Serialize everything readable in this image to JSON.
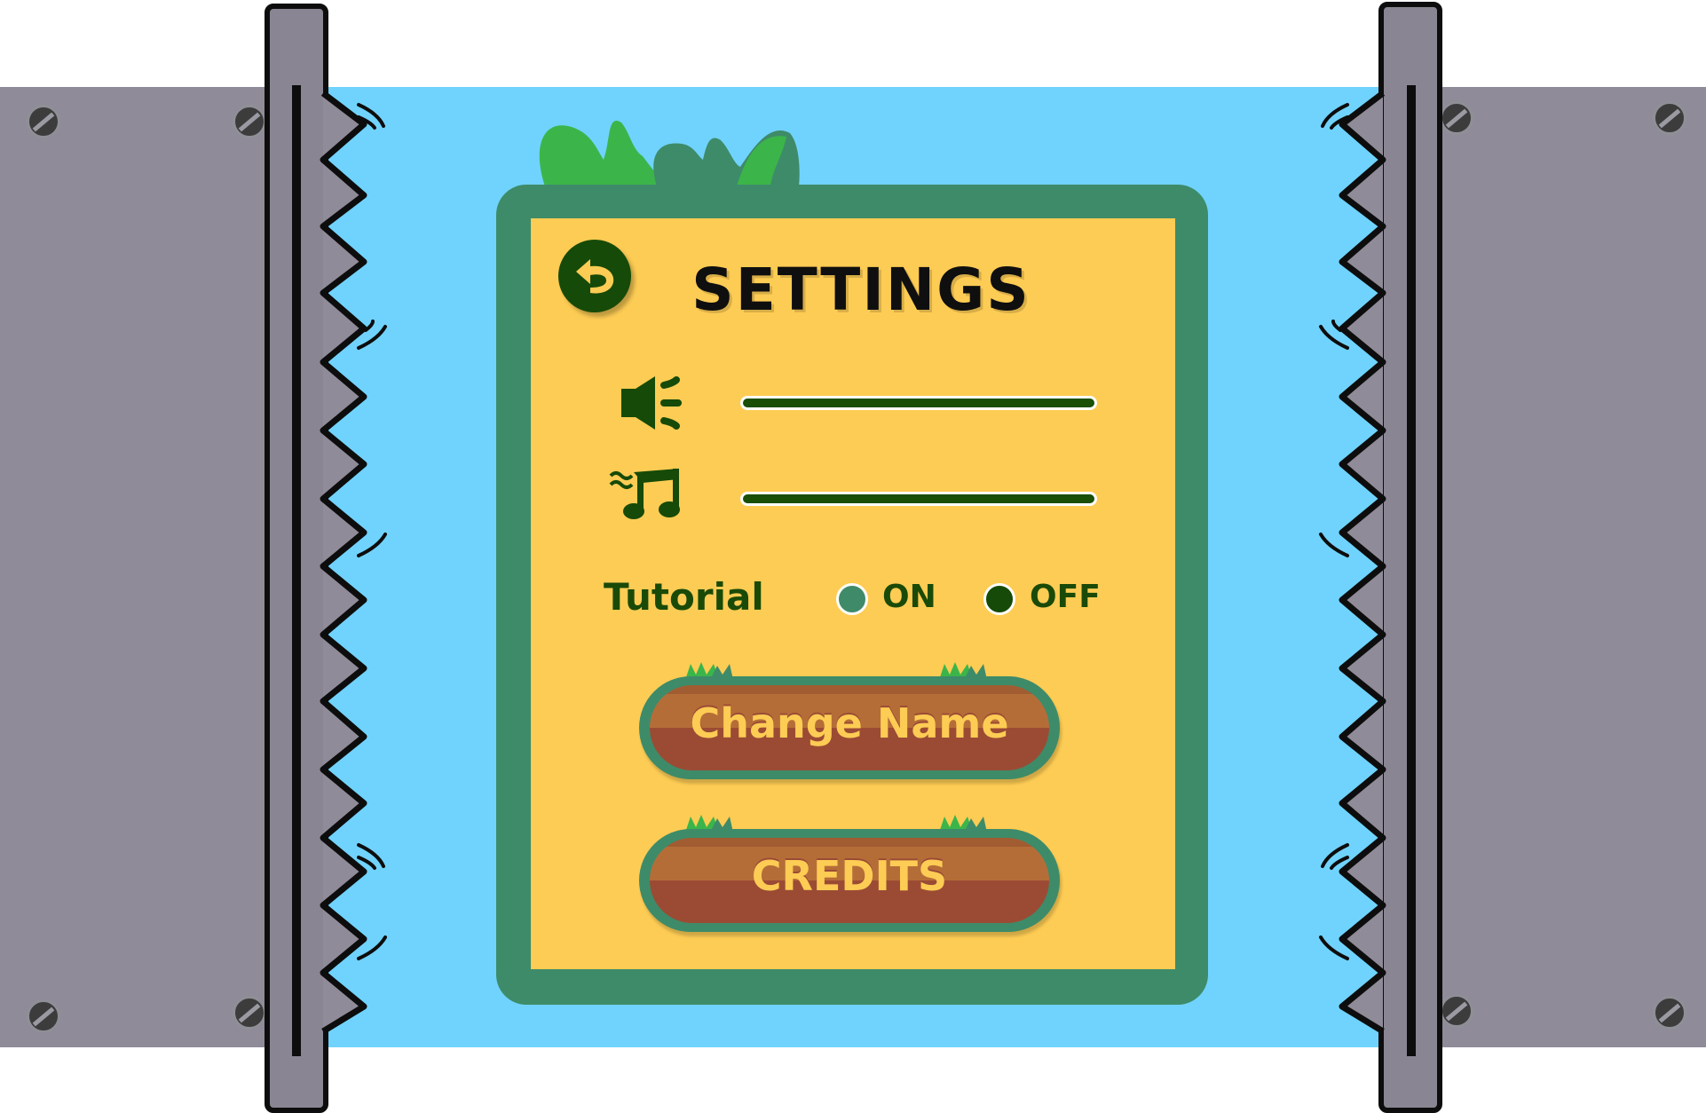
{
  "settings": {
    "title": "SETTINGS",
    "back_icon": "back-arrow-icon",
    "sound": {
      "icon": "speaker-icon",
      "level": 1.0
    },
    "music": {
      "icon": "music-note-icon",
      "level": 1.0
    },
    "tutorial": {
      "label": "Tutorial",
      "on_label": "ON",
      "off_label": "OFF",
      "selected": "OFF"
    },
    "buttons": {
      "change_name": "Change Name",
      "credits": "CREDITS"
    }
  },
  "colors": {
    "sky": "#70d3fd",
    "board_green": "#3e8b69",
    "card_yellow": "#fdcc54",
    "dark_green": "#164a08",
    "wood_light": "#b56d38",
    "wood_dark": "#9b4b34",
    "metal": "#908b98"
  }
}
